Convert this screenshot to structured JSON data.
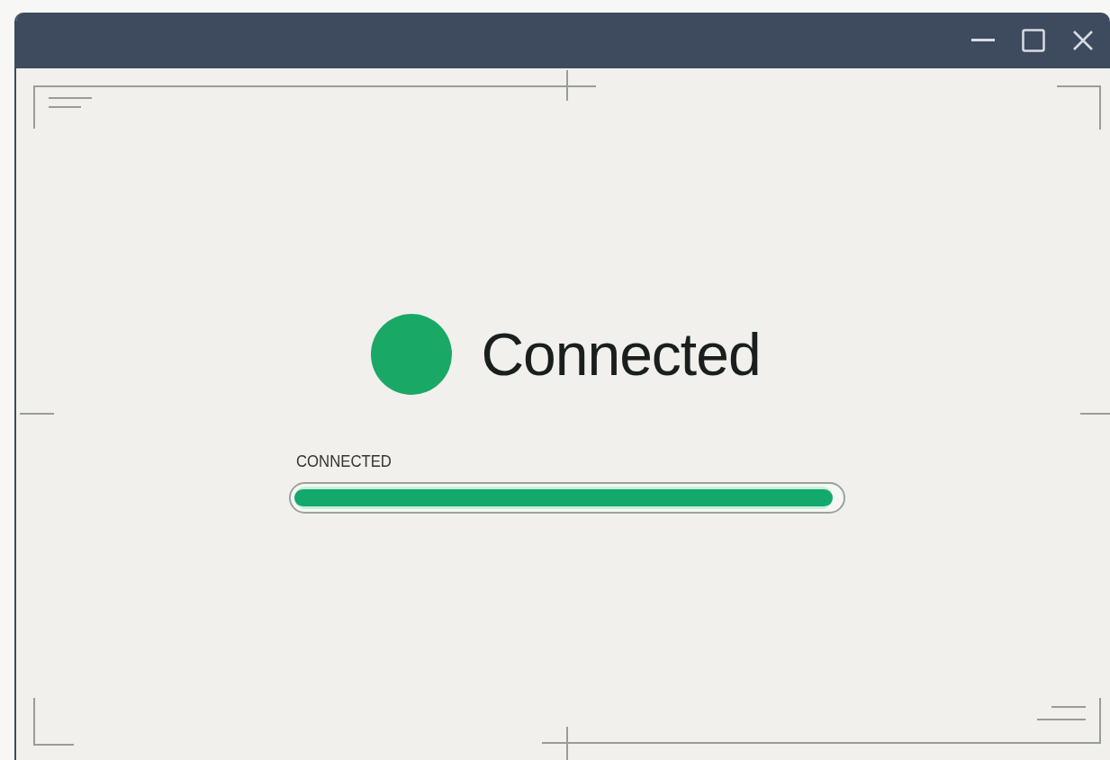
{
  "status": {
    "label": "Connected",
    "color": "#1aa866"
  },
  "progress": {
    "label": "CONNECTED",
    "level": 1.0
  }
}
